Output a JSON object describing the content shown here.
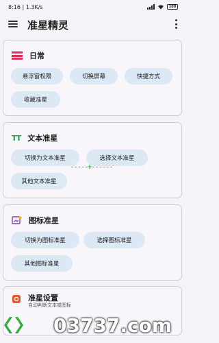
{
  "status_bar": {
    "time": "8:16",
    "speed": "1.3K/s",
    "battery": "100"
  },
  "app_bar": {
    "title": "准星精灵"
  },
  "cards": {
    "daily": {
      "title": "日常",
      "buttons": [
        "悬浮窗权限",
        "切换屏幕",
        "快捷方式",
        "收藏准星"
      ]
    },
    "text": {
      "title": "文本准星",
      "buttons": [
        "切换为文本准星",
        "选择文本准星",
        "其他文本准星"
      ]
    },
    "icon": {
      "title": "图标准星",
      "buttons": [
        "切换为图标准星",
        "选择图标准星",
        "其他图标准星"
      ]
    },
    "settings": {
      "title": "准星设置",
      "subtitle": "自动判断文本或图标"
    }
  },
  "watermark": {
    "text": "03737.com"
  },
  "colors": {
    "accent_chip": "#dce9f5",
    "daily_icon": "#d9305a",
    "text_icon": "#19a34a",
    "image_icon": "#7b3fb5",
    "settings_icon": "#e8552b",
    "crosshair": "#32c45a"
  }
}
